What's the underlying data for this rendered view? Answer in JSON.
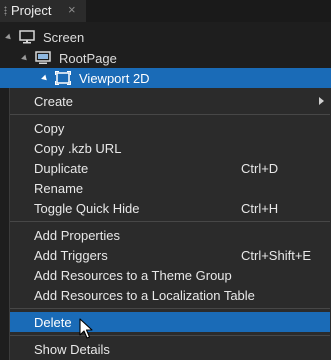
{
  "panel": {
    "title": "Project",
    "close_glyph": "×"
  },
  "tree": {
    "screen_label": "Screen",
    "rootpage_label": "RootPage",
    "viewport_label": "Viewport 2D"
  },
  "menu": {
    "create": "Create",
    "copy": "Copy",
    "copy_kzb_url": "Copy .kzb URL",
    "duplicate": "Duplicate",
    "duplicate_shortcut": "Ctrl+D",
    "rename": "Rename",
    "toggle_quick_hide": "Toggle Quick Hide",
    "toggle_quick_hide_shortcut": "Ctrl+H",
    "add_properties": "Add Properties",
    "add_triggers": "Add Triggers",
    "add_triggers_shortcut": "Ctrl+Shift+E",
    "add_resources_theme": "Add Resources to a Theme Group",
    "add_resources_localization": "Add Resources to a Localization Table",
    "delete": "Delete",
    "show_details": "Show Details"
  },
  "colors": {
    "selection": "#1a6bb7",
    "menu_bg": "#2b2b2b",
    "app_bg": "#1e1e1e"
  },
  "icons": [
    "grip-icon",
    "close-icon",
    "expand-arrow-icon",
    "monitor-icon",
    "page-icon",
    "viewport-icon",
    "submenu-arrow-icon",
    "mouse-cursor-icon"
  ]
}
